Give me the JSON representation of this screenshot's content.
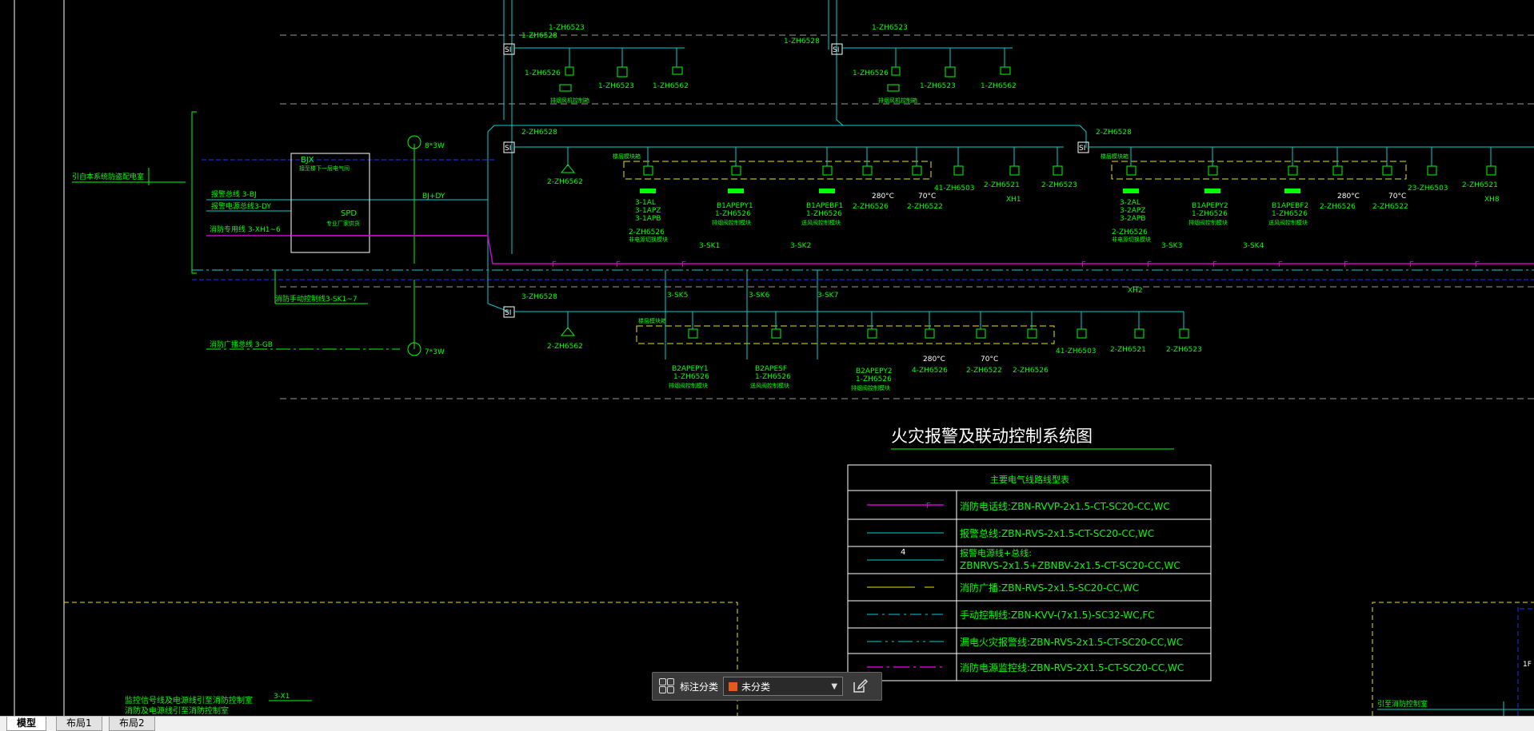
{
  "colors": {
    "background": "#000000",
    "cyan": "#00d0d0",
    "green": "#00ff00",
    "magenta": "#d000d0",
    "yellow": "#e6e600",
    "white": "#ffffff",
    "blue": "#2030ff"
  },
  "diagram": {
    "title": "火灾报警及联动控制系统图",
    "left_labels": {
      "source": "引自本系统防盗配电室",
      "bus1": "报警总线 3-BJ",
      "bus2": "报警电源总线3-DY",
      "bus3": "消防专用线 3-XH1~6",
      "manual": "消防手动控制线3-SK1~7",
      "broadcast": "消防广播总线 3-GB",
      "bottom_note1": "监控信号线及电源线引至消防控制室",
      "bottom_note2": "消防及电源线引至消防控制室"
    },
    "left_block": {
      "bjx": "BJX",
      "bjx_sub": "接至楼下一层电气间",
      "spd": "SPD",
      "spd_sub": "专业厂家供货"
    },
    "speakers": {
      "top": "8*3W",
      "bottom": "7*3W"
    },
    "bus_label": "BJ+DY",
    "si": "SI",
    "codes": {
      "c6523": "1-ZH6523",
      "c6528": "1-ZH6528",
      "c6526": "1-ZH6526",
      "c6562": "1-ZH6562",
      "top_note": "排烟风机控制箱",
      "r2_6528": "2-ZH6528",
      "r2_6562": "2-ZH6562",
      "r2_6526": "2-ZH6526",
      "r2_6522": "2-ZH6522",
      "r2_6503": "41-ZH6503",
      "r2_6521": "2-ZH6521",
      "r2_6523": "2-ZH6523",
      "r2_6503b": "23-ZH6503",
      "r2_6521b": "2-ZH6521",
      "r3_6528": "3-ZH6528",
      "r3_6562": "2-ZH6562",
      "r3_6526": "4-ZH6526",
      "r3_6522": "2-ZH6522",
      "r3_6526b": "2-ZH6526",
      "r3_6503": "41-ZH6503",
      "r3_6521": "2-ZH6521",
      "r3_6523": "2-ZH6523",
      "temp280": "280°C",
      "temp70": "70°C",
      "module_box": "楼层模块箱"
    },
    "groups_r2": [
      {
        "l1": "3-1AL",
        "l2": "3-1APZ",
        "l3": "3-1APB",
        "l4": "2-ZH6526",
        "l5": "非电源切换模块"
      },
      {
        "l1": "B1APEPY1",
        "l2": "1-ZH6526",
        "l3": "排烟阀控制模块"
      },
      {
        "l1": "B1APEBF1",
        "l2": "1-ZH6526",
        "l3": "送风阀控制模块"
      },
      {
        "l1": "3-2AL",
        "l2": "3-2APZ",
        "l3": "3-2APB",
        "l4": "2-ZH6526",
        "l5": "非电源切换模块"
      },
      {
        "l1": "B1APEPY2",
        "l2": "1-ZH6526",
        "l3": "排烟阀控制模块"
      },
      {
        "l1": "B1APEBF2",
        "l2": "1-ZH6526",
        "l3": "送风阀控制模块"
      }
    ],
    "groups_r3": [
      {
        "l1": "B2APEPY1",
        "l2": "1-ZH6526",
        "l3": "排烟阀控制模块"
      },
      {
        "l1": "B2APESF",
        "l2": "1-ZH6526",
        "l3": "送风阀控制模块"
      },
      {
        "l1": "B2APEPY2",
        "l2": "1-ZH6526",
        "l3": "排烟阀控制模块"
      }
    ],
    "sk": [
      "3-SK1",
      "3-SK2",
      "3-SK3",
      "3-SK4",
      "3-SK5",
      "3-SK6",
      "3-SK7"
    ],
    "xh": [
      "XH1",
      "XH2",
      "XH8"
    ],
    "flag_f": "F",
    "wire_four": "4",
    "bottom_x": "3-X1",
    "right_note": "引至消防控制室",
    "right_mark": "1F"
  },
  "legend": {
    "header": "主要电气线路线型表",
    "rows": [
      {
        "text": "消防电话线:ZBN-RVVP-2x1.5-CT-SC20-CC,WC",
        "style": "magenta-f"
      },
      {
        "text": "报警总线:ZBN-RVS-2x1.5-CT-SC20-CC,WC",
        "style": "cyan"
      },
      {
        "text": "报警电源线+总线:",
        "text2": "ZBNRVS-2x1.5+ZBNBV-2x1.5-CT-SC20-CC,WC",
        "style": "cyan-4"
      },
      {
        "text": "消防广播:ZBN-RVS-2x1.5-SC20-CC,WC",
        "style": "yellow-dash"
      },
      {
        "text": "手动控制线:ZBN-KVV-(7x1.5)-SC32-WC,FC",
        "style": "cyan-dashdot"
      },
      {
        "text": "漏电火灾报警线:ZBN-RVS-2x1.5-CT-SC20-CC,WC",
        "style": "cyan-dashdot2"
      },
      {
        "text": "消防电源监控线:ZBN-RVS-2X1.5-CT-SC20-CC,WC",
        "style": "magenta-dashdot"
      }
    ]
  },
  "annotation_toolbar": {
    "label": "标注分类",
    "selected": "未分类",
    "swatch": "#e35a1a"
  },
  "tabs": [
    "模型",
    "布局1",
    "布局2"
  ]
}
